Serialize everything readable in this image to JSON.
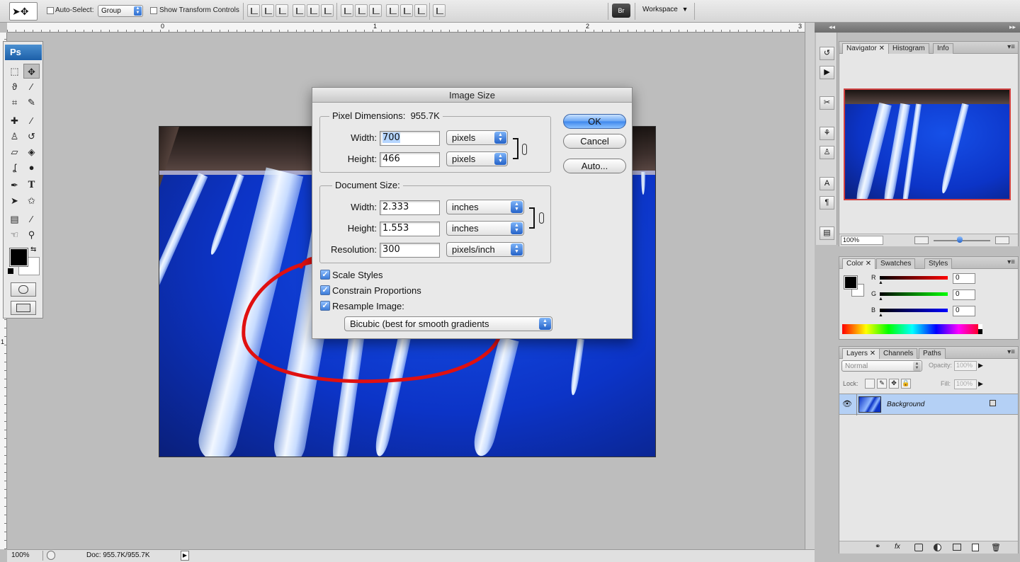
{
  "options_bar": {
    "auto_select_label": "Auto-Select:",
    "auto_select_value": "Group",
    "show_transform_label": "Show Transform Controls",
    "workspace_label": "Workspace",
    "bridge_label": "Br"
  },
  "ruler": {
    "marks": [
      "0",
      "1",
      "2",
      "3"
    ],
    "left_mark": "1"
  },
  "tools": {
    "logo": "Ps"
  },
  "dialog": {
    "title": "Image Size",
    "pixel_dimensions": {
      "label": "Pixel Dimensions:",
      "size": "955.7K",
      "width_label": "Width:",
      "width_value": "700",
      "width_unit": "pixels",
      "height_label": "Height:",
      "height_value": "466",
      "height_unit": "pixels"
    },
    "document_size": {
      "label": "Document Size:",
      "width_label": "Width:",
      "width_value": "2.333",
      "width_unit": "inches",
      "height_label": "Height:",
      "height_value": "1.553",
      "height_unit": "inches",
      "resolution_label": "Resolution:",
      "resolution_value": "300",
      "resolution_unit": "pixels/inch"
    },
    "options": {
      "scale_styles": "Scale Styles",
      "constrain_proportions": "Constrain Proportions",
      "resample_image": "Resample Image:",
      "resample_method": "Bicubic (best for smooth gradients"
    },
    "buttons": {
      "ok": "OK",
      "cancel": "Cancel",
      "auto": "Auto..."
    },
    "checked": {
      "scale_styles": true,
      "constrain_proportions": true,
      "resample_image": true
    }
  },
  "navigator_panel": {
    "tabs": [
      "Navigator",
      "Histogram",
      "Info"
    ],
    "zoom": "100%"
  },
  "color_panel": {
    "tabs": [
      "Color",
      "Swatches",
      "Styles"
    ],
    "channels": [
      {
        "label": "R",
        "value": "0"
      },
      {
        "label": "G",
        "value": "0"
      },
      {
        "label": "B",
        "value": "0"
      }
    ]
  },
  "layers_panel": {
    "tabs": [
      "Layers",
      "Channels",
      "Paths"
    ],
    "blend_mode": "Normal",
    "opacity_label": "Opacity:",
    "opacity_value": "100%",
    "lock_label": "Lock:",
    "fill_label": "Fill:",
    "fill_value": "100%",
    "layer_name": "Background"
  },
  "status_bar": {
    "zoom": "100%",
    "doc_info": "Doc: 955.7K/955.7K"
  },
  "colors": {
    "accent": "#3d86ec",
    "annotation": "#e01010",
    "sky": "#0c34c7"
  }
}
